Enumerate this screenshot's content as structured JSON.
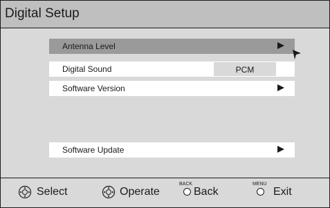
{
  "title": "Digital Setup",
  "menu": {
    "items": [
      {
        "label": "Antenna Level",
        "has_arrow": true,
        "selected": true
      },
      {
        "label": "Digital Sound",
        "value": "PCM"
      },
      {
        "label": "Software Version",
        "has_arrow": true
      },
      {
        "label": "Software Update",
        "has_arrow": true
      }
    ]
  },
  "footer": {
    "select": {
      "label": "Select",
      "icon": "dial-icon"
    },
    "operate": {
      "label": "Operate",
      "icon": "dial-icon"
    },
    "back": {
      "key": "BACK",
      "label": "Back"
    },
    "exit": {
      "key": "MENU",
      "label": "Exit"
    }
  },
  "colors": {
    "background": "#d9d9d9",
    "title_bar": "#bfbfbf",
    "highlight": "#9a9a9a",
    "item": "#ffffff",
    "text": "#1a1a1a"
  }
}
